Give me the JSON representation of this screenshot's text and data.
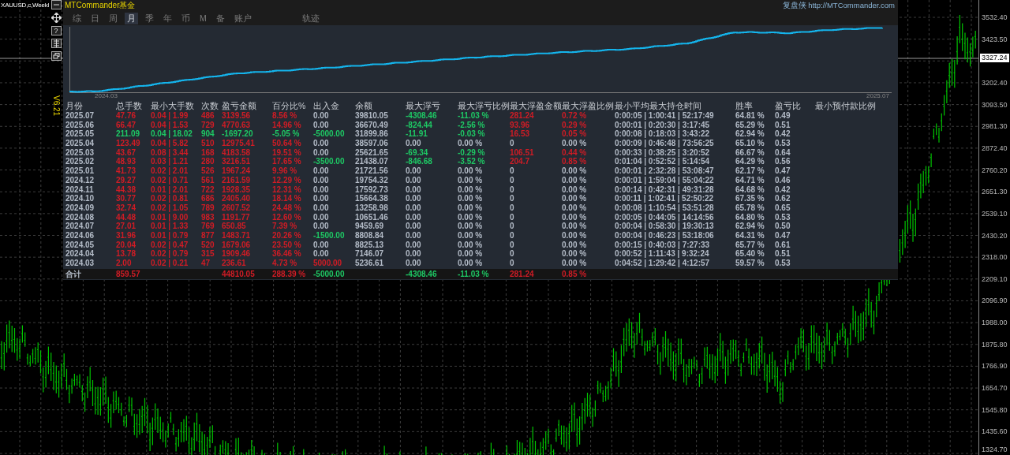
{
  "symbol": "XAUUSD,c,Weekl",
  "help_button": "?",
  "version": "V6.21",
  "panel": {
    "title": "MTCommander基金",
    "link": "复盘侠 http://MTCommander.com",
    "tabs": [
      {
        "label": "综",
        "selected": false
      },
      {
        "label": "日",
        "selected": false
      },
      {
        "label": "周",
        "selected": false
      },
      {
        "label": "月",
        "selected": true
      },
      {
        "label": "季",
        "selected": false
      },
      {
        "label": "年",
        "selected": false
      },
      {
        "label": "币",
        "selected": false
      },
      {
        "label": "M",
        "selected": false
      },
      {
        "label": "备",
        "selected": false
      },
      {
        "label": "账户",
        "selected": false
      }
    ],
    "side_tabs": [
      {
        "label": "轨迹",
        "selected": false
      }
    ],
    "equity_chart": {
      "start_label": "2024.03",
      "end_label": "2025.07"
    },
    "table": {
      "columns": [
        "月份",
        "总手数",
        "最小大手数",
        "次数",
        "盈亏金额",
        "百分比%",
        "出入金",
        "余额",
        "最大浮亏",
        "最大浮亏比例",
        "最大浮盈金额",
        "最大浮盈比例",
        "最小平均最大持仓时间",
        "胜率",
        "盈亏比",
        "最小预付款比例"
      ],
      "rows": [
        {
          "cells": [
            "2025.07",
            {
              "text": "47.76",
              "color": "#d01c25"
            },
            {
              "text": "0.04 | 1.99",
              "color": "#d01c25"
            },
            {
              "text": "486",
              "color": "#d01c25"
            },
            {
              "text": "3139.56",
              "color": "#d01c25"
            },
            {
              "text": "8.56 %",
              "color": "#d01c25"
            },
            "0.00",
            "39810.05",
            {
              "text": "-4308.46",
              "color": "#1ec864"
            },
            {
              "text": "-11.03 %",
              "color": "#1ec864"
            },
            {
              "text": "281.24",
              "color": "#d01c25"
            },
            {
              "text": "0.72 %",
              "color": "#d01c25"
            },
            "0:00:05 | 1:00:41 | 52:17:49",
            "64.81 %",
            "0.49"
          ]
        },
        {
          "cells": [
            "2025.06",
            {
              "text": "66.47",
              "color": "#d01c25"
            },
            {
              "text": "0.04 | 1.53",
              "color": "#d01c25"
            },
            {
              "text": "729",
              "color": "#d01c25"
            },
            {
              "text": "4770.63",
              "color": "#d01c25"
            },
            {
              "text": "14.96 %",
              "color": "#d01c25"
            },
            "0.00",
            "36670.49",
            {
              "text": "-824.44",
              "color": "#1ec864"
            },
            {
              "text": "-2.56 %",
              "color": "#1ec864"
            },
            {
              "text": "93.96",
              "color": "#d01c25"
            },
            {
              "text": "0.29 %",
              "color": "#d01c25"
            },
            "0:00:01 | 0:20:30 | 3:17:45",
            "65.29 %",
            "0.51"
          ]
        },
        {
          "cells": [
            "2025.05",
            {
              "text": "211.09",
              "color": "#1ec864"
            },
            {
              "text": "0.04 | 18.02",
              "color": "#1ec864"
            },
            {
              "text": "904",
              "color": "#1ec864"
            },
            {
              "text": "-1697.20",
              "color": "#1ec864"
            },
            {
              "text": "-5.05 %",
              "color": "#1ec864"
            },
            {
              "text": "-5000.00",
              "color": "#1ec864"
            },
            "31899.86",
            {
              "text": "-11.91",
              "color": "#1ec864"
            },
            {
              "text": "-0.03 %",
              "color": "#1ec864"
            },
            {
              "text": "16.53",
              "color": "#d01c25"
            },
            {
              "text": "0.05 %",
              "color": "#d01c25"
            },
            "0:00:08 | 0:18:03 | 3:43:22",
            "62.94 %",
            "0.42"
          ]
        },
        {
          "cells": [
            "2025.04",
            {
              "text": "123.49",
              "color": "#d01c25"
            },
            {
              "text": "0.04 | 5.82",
              "color": "#d01c25"
            },
            {
              "text": "510",
              "color": "#d01c25"
            },
            {
              "text": "12975.41",
              "color": "#d01c25"
            },
            {
              "text": "50.64 %",
              "color": "#d01c25"
            },
            "0.00",
            "38597.06",
            "0.00",
            "0.00 %",
            "0",
            "0.00 %",
            "0:00:09 | 0:46:48 | 73:56:25",
            "65.10 %",
            "0.53"
          ]
        },
        {
          "cells": [
            "2025.03",
            {
              "text": "43.67",
              "color": "#d01c25"
            },
            {
              "text": "0.08 | 3.44",
              "color": "#d01c25"
            },
            {
              "text": "168",
              "color": "#d01c25"
            },
            {
              "text": "4183.58",
              "color": "#d01c25"
            },
            {
              "text": "19.51 %",
              "color": "#d01c25"
            },
            "0.00",
            "25621.65",
            {
              "text": "-69.34",
              "color": "#1ec864"
            },
            {
              "text": "-0.29 %",
              "color": "#1ec864"
            },
            {
              "text": "106.51",
              "color": "#d01c25"
            },
            {
              "text": "0.44 %",
              "color": "#d01c25"
            },
            "0:00:33 | 0:38:25 | 3:20:52",
            "66.67 %",
            "0.64"
          ]
        },
        {
          "cells": [
            "2025.02",
            {
              "text": "48.93",
              "color": "#d01c25"
            },
            {
              "text": "0.03 | 1.21",
              "color": "#d01c25"
            },
            {
              "text": "280",
              "color": "#d01c25"
            },
            {
              "text": "3216.51",
              "color": "#d01c25"
            },
            {
              "text": "17.65 %",
              "color": "#d01c25"
            },
            {
              "text": "-3500.00",
              "color": "#1ec864"
            },
            "21438.07",
            {
              "text": "-846.68",
              "color": "#1ec864"
            },
            {
              "text": "-3.52 %",
              "color": "#1ec864"
            },
            {
              "text": "204.7",
              "color": "#d01c25"
            },
            {
              "text": "0.85 %",
              "color": "#d01c25"
            },
            "0:01:04 | 0:52:52 | 5:14:54",
            "64.29 %",
            "0.56"
          ]
        },
        {
          "cells": [
            "2025.01",
            {
              "text": "41.73",
              "color": "#d01c25"
            },
            {
              "text": "0.02 | 2.01",
              "color": "#d01c25"
            },
            {
              "text": "526",
              "color": "#d01c25"
            },
            {
              "text": "1967.24",
              "color": "#d01c25"
            },
            {
              "text": "9.96 %",
              "color": "#d01c25"
            },
            "0.00",
            "21721.56",
            "0.00",
            "0.00 %",
            "0",
            "0.00 %",
            "0:00:01 | 2:32:28 | 53:08:47",
            "62.17 %",
            "0.47"
          ]
        },
        {
          "cells": [
            "2024.12",
            {
              "text": "29.27",
              "color": "#d01c25"
            },
            {
              "text": "0.02 | 0.71",
              "color": "#d01c25"
            },
            {
              "text": "561",
              "color": "#d01c25"
            },
            {
              "text": "2161.59",
              "color": "#d01c25"
            },
            {
              "text": "12.29 %",
              "color": "#d01c25"
            },
            "0.00",
            "19754.32",
            "0.00",
            "0.00 %",
            "0",
            "0.00 %",
            "0:00:01 | 1:59:04 | 55:04:22",
            "64.71 %",
            "0.46"
          ]
        },
        {
          "cells": [
            "2024.11",
            {
              "text": "44.38",
              "color": "#d01c25"
            },
            {
              "text": "0.01 | 2.01",
              "color": "#d01c25"
            },
            {
              "text": "722",
              "color": "#d01c25"
            },
            {
              "text": "1928.35",
              "color": "#d01c25"
            },
            {
              "text": "12.31 %",
              "color": "#d01c25"
            },
            "0.00",
            "17592.73",
            "0.00",
            "0.00 %",
            "0",
            "0.00 %",
            "0:00:14 | 0:42:31 | 49:31:28",
            "64.68 %",
            "0.42"
          ]
        },
        {
          "cells": [
            "2024.10",
            {
              "text": "30.77",
              "color": "#d01c25"
            },
            {
              "text": "0.02 | 0.81",
              "color": "#d01c25"
            },
            {
              "text": "686",
              "color": "#d01c25"
            },
            {
              "text": "2405.40",
              "color": "#d01c25"
            },
            {
              "text": "18.14 %",
              "color": "#d01c25"
            },
            "0.00",
            "15664.38",
            "0.00",
            "0.00 %",
            "0",
            "0.00 %",
            "0:00:11 | 1:02:41 | 52:50:22",
            "67.35 %",
            "0.62"
          ]
        },
        {
          "cells": [
            "2024.09",
            {
              "text": "32.74",
              "color": "#d01c25"
            },
            {
              "text": "0.02 | 1.05",
              "color": "#d01c25"
            },
            {
              "text": "789",
              "color": "#d01c25"
            },
            {
              "text": "2607.52",
              "color": "#d01c25"
            },
            {
              "text": "24.48 %",
              "color": "#d01c25"
            },
            "0.00",
            "13258.98",
            "0.00",
            "0.00 %",
            "0",
            "0.00 %",
            "0:00:08 | 1:10:54 | 53:51:28",
            "65.78 %",
            "0.65"
          ]
        },
        {
          "cells": [
            "2024.08",
            {
              "text": "44.48",
              "color": "#d01c25"
            },
            {
              "text": "0.01 | 9.00",
              "color": "#d01c25"
            },
            {
              "text": "983",
              "color": "#d01c25"
            },
            {
              "text": "1191.77",
              "color": "#d01c25"
            },
            {
              "text": "12.60 %",
              "color": "#d01c25"
            },
            "0.00",
            "10651.46",
            "0.00",
            "0.00 %",
            "0",
            "0.00 %",
            "0:00:05 | 0:44:05 | 14:14:56",
            "64.80 %",
            "0.53"
          ]
        },
        {
          "cells": [
            "2024.07",
            {
              "text": "27.01",
              "color": "#d01c25"
            },
            {
              "text": "0.01 | 1.33",
              "color": "#d01c25"
            },
            {
              "text": "769",
              "color": "#d01c25"
            },
            {
              "text": "650.85",
              "color": "#d01c25"
            },
            {
              "text": "7.39 %",
              "color": "#d01c25"
            },
            "0.00",
            "9459.69",
            "0.00",
            "0.00 %",
            "0",
            "0.00 %",
            "0:00:04 | 0:58:30 | 19:30:13",
            "62.94 %",
            "0.50"
          ]
        },
        {
          "cells": [
            "2024.06",
            {
              "text": "31.96",
              "color": "#d01c25"
            },
            {
              "text": "0.01 | 0.79",
              "color": "#d01c25"
            },
            {
              "text": "877",
              "color": "#d01c25"
            },
            {
              "text": "1483.71",
              "color": "#d01c25"
            },
            {
              "text": "20.26 %",
              "color": "#d01c25"
            },
            {
              "text": "-1500.00",
              "color": "#1ec864"
            },
            "8808.84",
            "0.00",
            "0.00 %",
            "0",
            "0.00 %",
            "0:00:04 | 0:46:23 | 53:18:06",
            "64.31 %",
            "0.47"
          ]
        },
        {
          "cells": [
            "2024.05",
            {
              "text": "20.04",
              "color": "#d01c25"
            },
            {
              "text": "0.02 | 0.47",
              "color": "#d01c25"
            },
            {
              "text": "520",
              "color": "#d01c25"
            },
            {
              "text": "1679.06",
              "color": "#d01c25"
            },
            {
              "text": "23.50 %",
              "color": "#d01c25"
            },
            "0.00",
            "8825.13",
            "0.00",
            "0.00 %",
            "0",
            "0.00 %",
            "0:00:15 | 0:40:03 | 7:27:33",
            "65.77 %",
            "0.61"
          ]
        },
        {
          "cells": [
            "2024.04",
            {
              "text": "13.78",
              "color": "#d01c25"
            },
            {
              "text": "0.02 | 0.79",
              "color": "#d01c25"
            },
            {
              "text": "315",
              "color": "#d01c25"
            },
            {
              "text": "1909.46",
              "color": "#d01c25"
            },
            {
              "text": "36.46 %",
              "color": "#d01c25"
            },
            "0.00",
            "7146.07",
            "0.00",
            "0.00 %",
            "0",
            "0.00 %",
            "0:00:52 | 1:11:43 | 9:32:24",
            "65.40 %",
            "0.51"
          ]
        },
        {
          "cells": [
            "2024.03",
            {
              "text": "2.00",
              "color": "#d01c25"
            },
            {
              "text": "0.02 | 0.21",
              "color": "#d01c25"
            },
            {
              "text": "47",
              "color": "#d01c25"
            },
            {
              "text": "236.61",
              "color": "#d01c25"
            },
            {
              "text": "4.73 %",
              "color": "#d01c25"
            },
            {
              "text": "5000.00",
              "color": "#d01c25"
            },
            "5236.61",
            "0.00",
            "0.00 %",
            "0",
            "0.00 %",
            "0:04:52 | 1:29:42 | 4:12:57",
            "59.57 %",
            "0.53"
          ]
        }
      ],
      "total": {
        "cells": [
          "合计",
          {
            "text": "859.57",
            "color": "#d01c25"
          },
          null,
          null,
          {
            "text": "44810.05",
            "color": "#d01c25"
          },
          {
            "text": "288.39 %",
            "color": "#d01c25"
          },
          {
            "text": "-5000.00",
            "color": "#1ec864"
          },
          null,
          {
            "text": "-4308.46",
            "color": "#1ec864"
          },
          {
            "text": "-11.03 %",
            "color": "#1ec864"
          },
          {
            "text": "281.24",
            "color": "#d01c25"
          },
          {
            "text": "0.85 %",
            "color": "#d01c25"
          }
        ]
      }
    }
  },
  "price_axis": {
    "current_price": "3327.24",
    "labels": [
      "3532.40",
      "3423.50",
      "3202.40",
      "3093.50",
      "2981.30",
      "2872.40",
      "2760.20",
      "2651.30",
      "2539.10",
      "2430.20",
      "2318.00",
      "2209.10",
      "2096.90",
      "1988.00",
      "1875.80",
      "1766.90",
      "1654.70",
      "1545.80",
      "1435.60",
      "1324.70"
    ]
  }
}
